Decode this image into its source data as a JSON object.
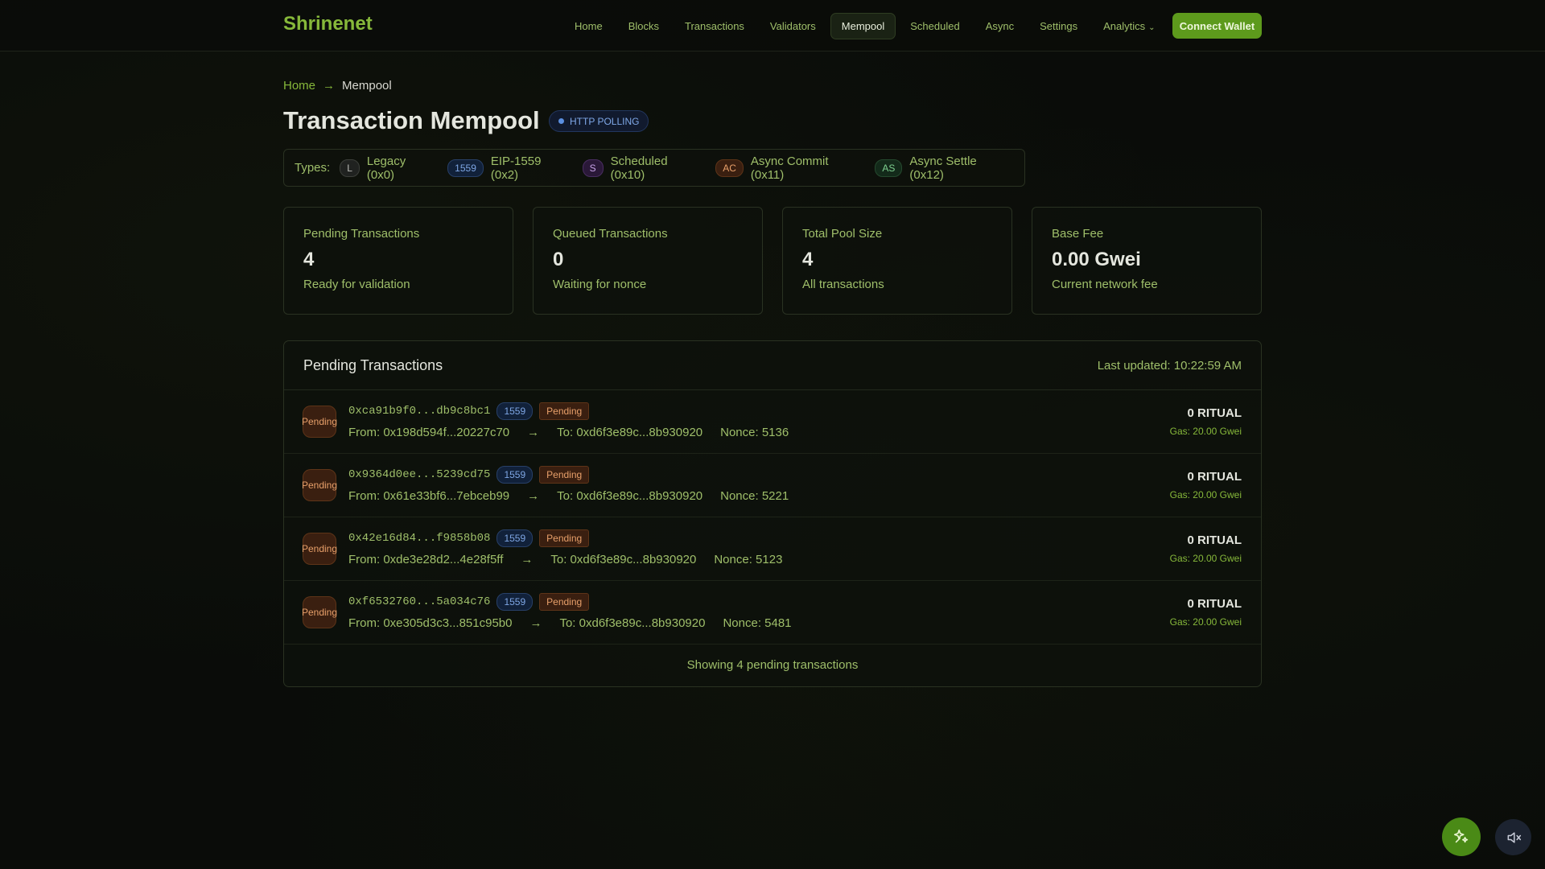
{
  "nav": {
    "brand": "Shrinenet",
    "links": [
      "Home",
      "Blocks",
      "Transactions",
      "Validators",
      "Mempool",
      "Scheduled",
      "Async",
      "Settings",
      "Analytics"
    ],
    "active": "Mempool",
    "connect_label": "Connect Wallet"
  },
  "breadcrumb": {
    "home": "Home",
    "separator": "→",
    "current": "Mempool"
  },
  "page": {
    "title": "Transaction Mempool",
    "live_badge": "HTTP POLLING"
  },
  "types": {
    "label": "Types:",
    "items": [
      {
        "chip": "L",
        "label": "Legacy (0x0)"
      },
      {
        "chip": "1559",
        "label": "EIP-1559 (0x2)"
      },
      {
        "chip": "S",
        "label": "Scheduled (0x10)"
      },
      {
        "chip": "AC",
        "label": "Async Commit (0x11)"
      },
      {
        "chip": "AS",
        "label": "Async Settle (0x12)"
      }
    ]
  },
  "stats": [
    {
      "label": "Pending Transactions",
      "value": "4",
      "sub": "Ready for validation"
    },
    {
      "label": "Queued Transactions",
      "value": "0",
      "sub": "Waiting for nonce"
    },
    {
      "label": "Total Pool Size",
      "value": "4",
      "sub": "All transactions"
    },
    {
      "label": "Base Fee",
      "value": "0.00 Gwei",
      "sub": "Current network fee"
    }
  ],
  "pending": {
    "title": "Pending Transactions",
    "updated": "Last updated: 10:22:59 AM",
    "rows": [
      {
        "status": "Pending",
        "hash": "0xca91b9f0...db9c8bc1",
        "type": "1559",
        "badge": "Pending",
        "from": "From: 0x198d594f...20227c70",
        "arrow": "→",
        "to": "To: 0xd6f3e89c...8b930920",
        "nonce": "Nonce: 5136",
        "amount": "0 RITUAL",
        "gas": "Gas: 20.00 Gwei"
      },
      {
        "status": "Pending",
        "hash": "0x9364d0ee...5239cd75",
        "type": "1559",
        "badge": "Pending",
        "from": "From: 0x61e33bf6...7ebceb99",
        "arrow": "→",
        "to": "To: 0xd6f3e89c...8b930920",
        "nonce": "Nonce: 5221",
        "amount": "0 RITUAL",
        "gas": "Gas: 20.00 Gwei"
      },
      {
        "status": "Pending",
        "hash": "0x42e16d84...f9858b08",
        "type": "1559",
        "badge": "Pending",
        "from": "From: 0xde3e28d2...4e28f5ff",
        "arrow": "→",
        "to": "To: 0xd6f3e89c...8b930920",
        "nonce": "Nonce: 5123",
        "amount": "0 RITUAL",
        "gas": "Gas: 20.00 Gwei"
      },
      {
        "status": "Pending",
        "hash": "0xf6532760...5a034c76",
        "type": "1559",
        "badge": "Pending",
        "from": "From: 0xe305d3c3...851c95b0",
        "arrow": "→",
        "to": "To: 0xd6f3e89c...8b930920",
        "nonce": "Nonce: 5481",
        "amount": "0 RITUAL",
        "gas": "Gas: 20.00 Gwei"
      }
    ],
    "footer": "Showing 4 pending transactions"
  },
  "fabs": {
    "ai_icon": "sparkle-icon",
    "mute_icon": "speaker-muted-icon"
  },
  "colors": {
    "accent": "#86b83a",
    "connect": "#5d9a1c",
    "pending": "#e8a06a",
    "eip1559": "#7ea6e4"
  }
}
